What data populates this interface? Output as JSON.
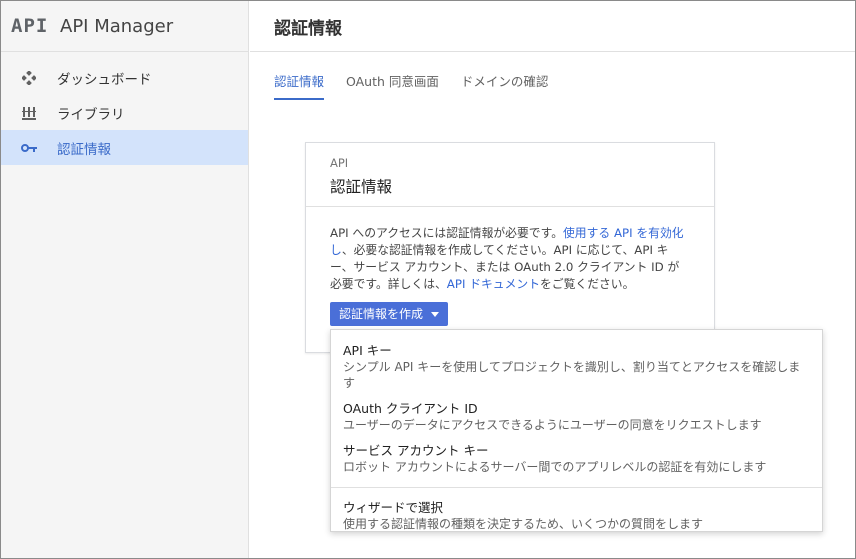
{
  "brand": {
    "logo": "API",
    "title": "API Manager"
  },
  "sidebar": {
    "items": [
      {
        "label": "ダッシュボード",
        "icon": "dashboard-icon"
      },
      {
        "label": "ライブラリ",
        "icon": "library-icon"
      },
      {
        "label": "認証情報",
        "icon": "key-icon",
        "active": true
      }
    ]
  },
  "header": {
    "title": "認証情報"
  },
  "tabs": [
    {
      "label": "認証情報",
      "active": true
    },
    {
      "label": "OAuth 同意画面"
    },
    {
      "label": "ドメインの確認"
    }
  ],
  "card": {
    "kicker": "API",
    "title": "認証情報",
    "body": {
      "text1": "API へのアクセスには認証情報が必要です。",
      "link1": "使用する API を有効化し",
      "text2": "、必要な認証情報を作成してください。API に応じて、API キー、サービス アカウント、または OAuth 2.0 クライアント ID が必要です。詳しくは、",
      "link2": "API ドキュメント",
      "text3": "をご覧ください。"
    },
    "create_button": "認証情報を作成"
  },
  "dropdown": {
    "items": [
      {
        "title": "API キー",
        "desc": "シンプル API キーを使用してプロジェクトを識別し、割り当てとアクセスを確認します"
      },
      {
        "title": "OAuth クライアント ID",
        "desc": "ユーザーのデータにアクセスできるようにユーザーの同意をリクエストします"
      },
      {
        "title": "サービス アカウント キー",
        "desc": "ロボット アカウントによるサーバー間でのアプリレベルの認証を有効にします"
      },
      {
        "title": "ウィザードで選択",
        "desc": "使用する認証情報の種類を決定するため、いくつかの質問をします"
      }
    ]
  },
  "colors": {
    "accent": "#3b6bc9",
    "button": "#4a6fd8",
    "active_bg": "#d3e3fb"
  }
}
